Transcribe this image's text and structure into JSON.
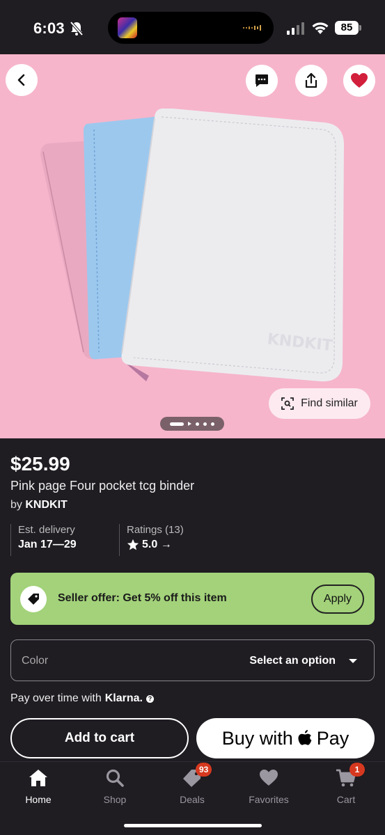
{
  "status_bar": {
    "time": "6:03",
    "battery": "85",
    "icons": [
      "bell-slash-icon",
      "signal-icon",
      "wifi-icon",
      "battery-icon"
    ]
  },
  "hero": {
    "find_similar_label": "Find similar",
    "carousel_total": 5,
    "carousel_active": 1,
    "background_color": "#f6b5cb"
  },
  "product": {
    "price": "$25.99",
    "title": "Pink page Four pocket tcg binder",
    "by_prefix": "by",
    "seller": "KNDKIT",
    "delivery_label": "Est. delivery",
    "delivery_value": "Jan 17—29",
    "ratings_label": "Ratings (13)",
    "ratings_value": "5.0 →"
  },
  "offer": {
    "text": "Seller offer: Get 5% off this item",
    "apply_label": "Apply",
    "color": "#a3d27a"
  },
  "color_select": {
    "label": "Color",
    "value": "Select an option"
  },
  "klarna": {
    "prefix": "Pay over time with",
    "brand": "Klarna.",
    "help": "?"
  },
  "actions": {
    "add_to_cart": "Add to cart",
    "buy_with": "Buy with",
    "pay": "Pay"
  },
  "tabs": [
    {
      "label": "Home",
      "icon": "home-icon",
      "active": true
    },
    {
      "label": "Shop",
      "icon": "search-icon"
    },
    {
      "label": "Deals",
      "icon": "tag-icon",
      "badge": "93"
    },
    {
      "label": "Favorites",
      "icon": "heart-icon"
    },
    {
      "label": "Cart",
      "icon": "cart-icon",
      "badge": "1"
    }
  ]
}
